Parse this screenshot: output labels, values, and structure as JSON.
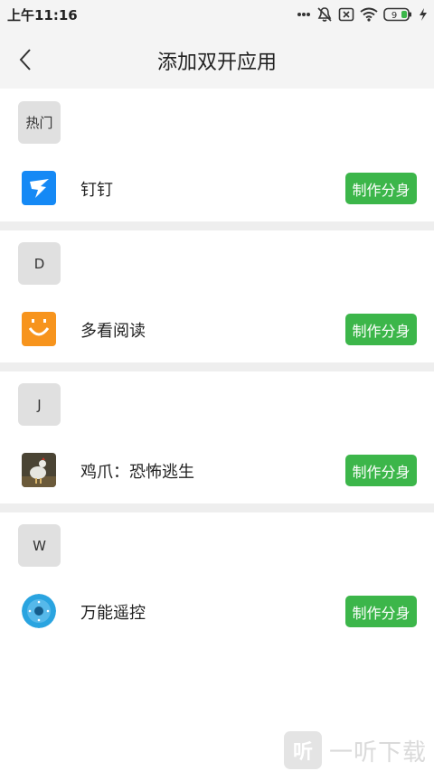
{
  "status_bar": {
    "time": "上午11:16",
    "battery": "9"
  },
  "header": {
    "title": "添加双开应用"
  },
  "sections": [
    {
      "letter": "热门",
      "app": {
        "name": "钉钉",
        "icon": "dingtalk-icon",
        "button": "制作分身"
      }
    },
    {
      "letter": "D",
      "app": {
        "name": "多看阅读",
        "icon": "duokan-icon",
        "button": "制作分身"
      }
    },
    {
      "letter": "J",
      "app": {
        "name": "鸡爪：恐怖逃生",
        "icon": "chicken-game-icon",
        "button": "制作分身"
      }
    },
    {
      "letter": "W",
      "app": {
        "name": "万能遥控",
        "icon": "remote-control-icon",
        "button": "制作分身"
      }
    }
  ],
  "watermark": {
    "logo": "听",
    "text": "一听下载"
  },
  "colors": {
    "accent_green": "#3cb64a",
    "header_bg": "#f4f4f4",
    "divider": "#eeeeee"
  }
}
